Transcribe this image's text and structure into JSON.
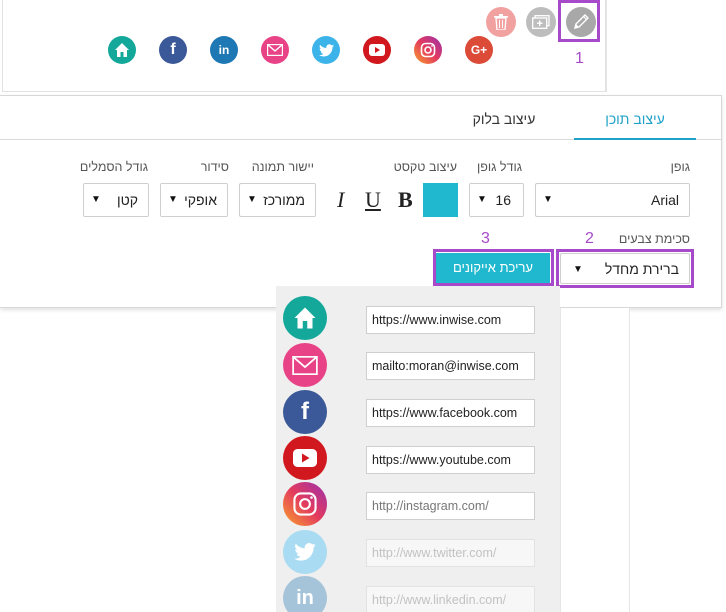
{
  "toolbar": {
    "delete_icon": "trash-icon",
    "copy_icon": "duplicate-icon",
    "edit_icon": "pencil-icon"
  },
  "annotations": {
    "n1": "1",
    "n2": "2",
    "n3": "3"
  },
  "social_preview": [
    {
      "name": "home",
      "glyph": "⌂",
      "color": "#14a89b"
    },
    {
      "name": "facebook",
      "glyph": "f",
      "color": "#3b5998"
    },
    {
      "name": "linkedin",
      "glyph": "in",
      "color": "#1e78b4"
    },
    {
      "name": "email",
      "glyph": "✉",
      "color": "#e94387"
    },
    {
      "name": "twitter",
      "glyph": "t",
      "color": "#3cb4ea"
    },
    {
      "name": "youtube",
      "glyph": "▶",
      "color": "#d0181e"
    },
    {
      "name": "instagram",
      "glyph": "◎",
      "color": "#c6336f"
    },
    {
      "name": "google-plus",
      "glyph": "G+",
      "color": "#dc4a38"
    }
  ],
  "tabs": {
    "content": "עיצוב תוכן",
    "block": "עיצוב בלוק"
  },
  "labels": {
    "font": "גופן",
    "font_size": "גודל גופן",
    "text_style": "עיצוב טקסט",
    "image_align": "יישור תמונה",
    "order": "סידור",
    "icon_size": "גודל הסמלים",
    "color_scheme": "סכימת צבעים"
  },
  "values": {
    "font": "Arial",
    "font_size": "16",
    "image_align": "ממורכז",
    "order": "אופקי",
    "icon_size": "קטן",
    "color_scheme": "ברירת מחדל",
    "text_color": "#1fb8ce"
  },
  "format": {
    "bold": "B",
    "underline": "U",
    "italic": "I"
  },
  "edit_icons_button": "עריכת אייקונים",
  "icon_rows": [
    {
      "name": "home",
      "glyph": "⌂",
      "color": "#14a89b",
      "url": "https://www.inwise.com",
      "state": "active"
    },
    {
      "name": "email",
      "glyph": "✉",
      "color": "#e94387",
      "url": "mailto:moran@inwise.com",
      "state": "active"
    },
    {
      "name": "facebook",
      "glyph": "f",
      "color": "#3b5998",
      "url": "https://www.facebook.com",
      "state": "active"
    },
    {
      "name": "youtube",
      "glyph": "▶",
      "color": "#d0181e",
      "url": "https://www.youtube.com",
      "state": "active"
    },
    {
      "name": "instagram",
      "glyph": "◎",
      "color": "#c6336f",
      "url": "http://instagram.com/",
      "state": "dim"
    },
    {
      "name": "twitter",
      "glyph": "t",
      "color": "#a9dcf3",
      "url": "http://www.twitter.com/",
      "state": "faded"
    },
    {
      "name": "linkedin",
      "glyph": "in",
      "color": "#a5c4da",
      "url": "http://www.linkedin.com/",
      "state": "faded"
    }
  ]
}
